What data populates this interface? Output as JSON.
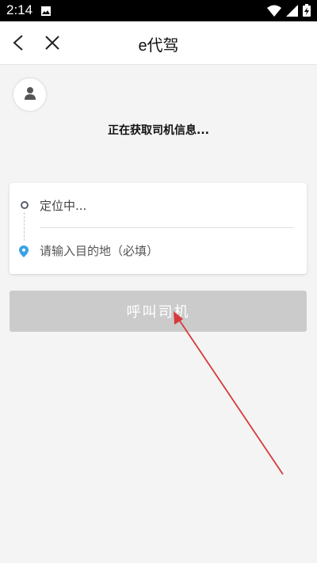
{
  "status_bar": {
    "time": "2:14",
    "icons": [
      "image-icon",
      "wifi-icon",
      "signal-icon",
      "battery-charging-icon"
    ]
  },
  "nav": {
    "title": "e代驾",
    "icons": [
      "back-arrow-icon",
      "close-icon"
    ]
  },
  "driver": {
    "avatar_icon": "person-icon",
    "status_text": "正在获取司机信息..."
  },
  "route": {
    "origin_text": "定位中...",
    "destination_placeholder": "请输入目的地（必填）",
    "destination_value": ""
  },
  "actions": {
    "call_driver_label": "呼叫司机"
  },
  "colors": {
    "button_disabled": "#cbcbcb",
    "annotation_arrow": "#d63a3a",
    "pin_blue": "#3aa0e8"
  }
}
